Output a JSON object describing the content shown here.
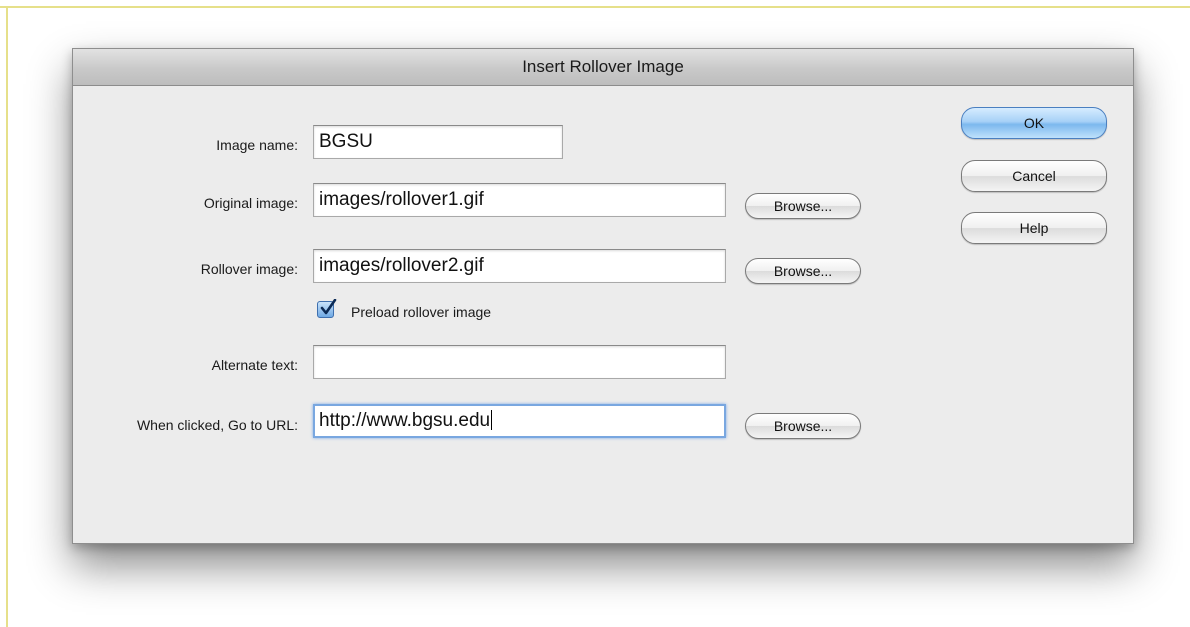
{
  "dialog": {
    "title": "Insert Rollover Image"
  },
  "form": {
    "image_name": {
      "label": "Image name:",
      "value": "BGSU"
    },
    "original_image": {
      "label": "Original image:",
      "value": "images/rollover1.gif",
      "browse_label": "Browse..."
    },
    "rollover_image": {
      "label": "Rollover image:",
      "value": "images/rollover2.gif",
      "browse_label": "Browse..."
    },
    "preload": {
      "label": "Preload rollover image",
      "checked": true
    },
    "alternate_text": {
      "label": "Alternate text:",
      "value": ""
    },
    "go_to_url": {
      "label": "When clicked, Go to URL:",
      "value": "http://www.bgsu.edu",
      "browse_label": "Browse..."
    }
  },
  "buttons": {
    "ok": "OK",
    "cancel": "Cancel",
    "help": "Help"
  },
  "icons": {
    "checkbox": "checkmark-icon"
  },
  "colors": {
    "default_button": "#7cb8ee",
    "focus_ring": "#79a7e0",
    "dialog_bg": "#ececec",
    "frame_line": "#e6e08a"
  }
}
